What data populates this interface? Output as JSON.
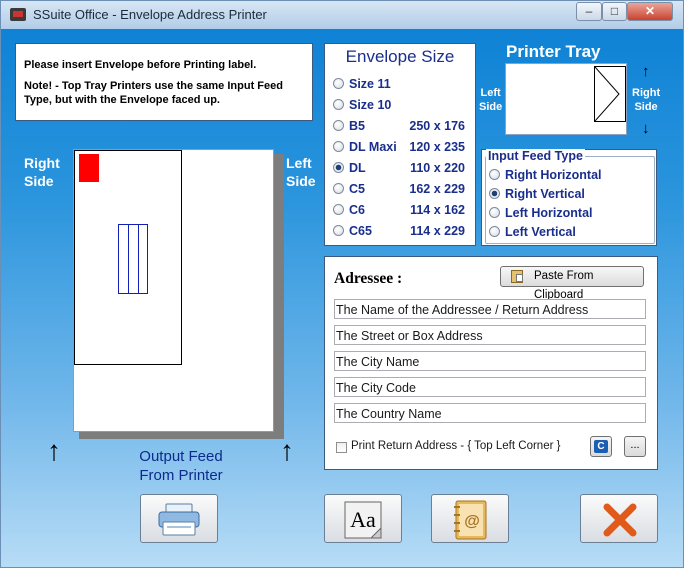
{
  "window": {
    "title": "SSuite Office - Envelope Address Printer"
  },
  "note": {
    "line1": "Please insert Envelope before Printing label.",
    "line2": "Note!  -  Top Tray Printers use the same Input Feed Type, but  with the Envelope faced up."
  },
  "envelope_size": {
    "title": "Envelope Size",
    "selected": "DL",
    "options": [
      {
        "name": "Size 11",
        "dims": ""
      },
      {
        "name": "Size 10",
        "dims": ""
      },
      {
        "name": "B5",
        "dims": "250 x 176"
      },
      {
        "name": "DL Maxi",
        "dims": "120 x 235"
      },
      {
        "name": "DL",
        "dims": "110 x 220"
      },
      {
        "name": "C5",
        "dims": "162 x 229"
      },
      {
        "name": "C6",
        "dims": "114 x 162"
      },
      {
        "name": "C65",
        "dims": "114 x 229"
      }
    ]
  },
  "printer_tray": {
    "title": "Printer Tray",
    "left_label_1": "Left",
    "left_label_2": "Side",
    "right_label_1": "Right",
    "right_label_2": "Side",
    "up_arrow": "↑",
    "down_arrow": "↓"
  },
  "input_feed": {
    "title": "Input Feed Type",
    "selected": "Right Vertical",
    "options": [
      "Right Horizontal",
      "Right Vertical",
      "Left Horizontal",
      "Left Vertical"
    ]
  },
  "preview": {
    "right_side_1": "Right",
    "right_side_2": "Side",
    "left_side_1": "Left",
    "left_side_2": "Side",
    "output_1": "Output Feed",
    "output_2": "From Printer",
    "arrow": "↑"
  },
  "addressee": {
    "heading": "Adressee :",
    "paste_button": "Paste From Clipboard",
    "fields": [
      "The Name of the Addressee / Return Address",
      "The Street or Box Address",
      "The City Name",
      "The City Code",
      "The Country Name"
    ],
    "print_return_label": "Print Return Address - { Top Left Corner }",
    "print_return_checked": false,
    "more_button": "..."
  },
  "toolbar": {
    "print": "print-icon",
    "font": "font-icon",
    "address_book": "address-book-icon",
    "close": "close-icon"
  },
  "colors": {
    "accent_text": "#1a2e8c",
    "stamp": "#ff0000",
    "close_x": "#e05a1a"
  }
}
